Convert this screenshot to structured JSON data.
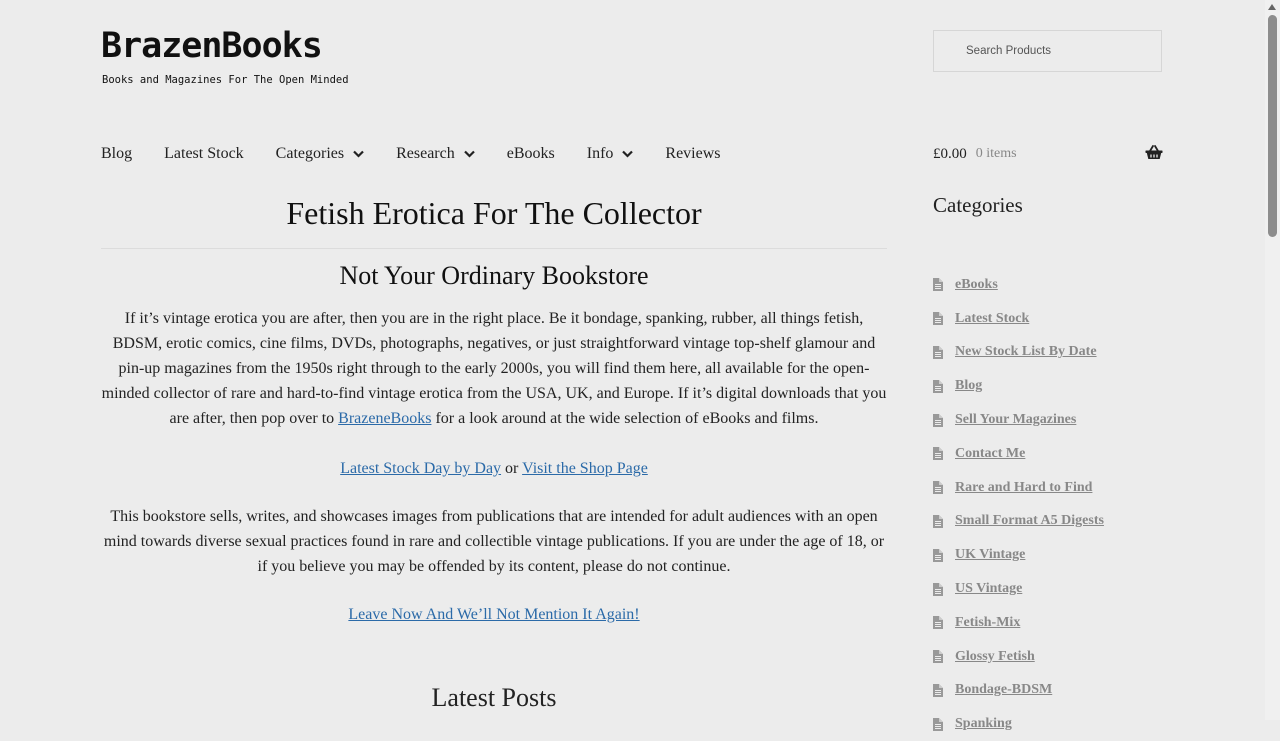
{
  "header": {
    "site_title": "BrazenBooks",
    "tagline": "Books and Magazines For The Open Minded",
    "search_placeholder": "Search Products"
  },
  "nav": {
    "items": [
      {
        "label": "Blog",
        "dropdown": false
      },
      {
        "label": "Latest Stock",
        "dropdown": false
      },
      {
        "label": "Categories",
        "dropdown": true
      },
      {
        "label": "Research",
        "dropdown": true
      },
      {
        "label": "eBooks",
        "dropdown": false
      },
      {
        "label": "Info",
        "dropdown": true
      },
      {
        "label": "Reviews",
        "dropdown": false
      }
    ]
  },
  "cart": {
    "amount": "£0.00",
    "items": "0 items"
  },
  "main": {
    "title": "Fetish Erotica For The Collector",
    "subtitle": "Not Your Ordinary Bookstore",
    "intro_text": "If it’s vintage erotica you are after, then you are in the right place. Be it bondage, spanking, rubber, all things fetish, BDSM, erotic comics, cine films, DVDs, photographs, negatives, or just straightforward vintage top-shelf glamour and pin-up magazines from the 1950s right through to the early 2000s, you will find them here, all available for the open-minded collector of rare and hard-to-find vintage erotica from the USA, UK, and Europe. If it’s digital downloads that you are after, then pop over to ",
    "intro_link": "BrazeneBooks",
    "intro_end": " for a look around at the wide selection of eBooks and films.",
    "link_latest": "Latest Stock Day by Day",
    "link_or": " or ",
    "link_shop": "Visit the Shop Page",
    "warning_text": "This bookstore sells, writes, and showcases images from publications that are intended for adult audiences with an open mind towards diverse sexual practices found in rare and collectible vintage publications. If you are under the age of 18, or if you believe you may be offended by its content, please do not continue.",
    "leave_link": "Leave Now And We’ll Not Mention It Again!",
    "latest_posts": "Latest Posts"
  },
  "sidebar": {
    "title": "Categories",
    "items": [
      "eBooks",
      "Latest Stock",
      "New Stock List By Date",
      "Blog",
      "Sell Your Magazines",
      "Contact Me",
      "Rare and Hard to Find",
      "Small Format A5 Digests",
      "UK Vintage",
      "US Vintage",
      "Fetish-Mix",
      "Glossy Fetish",
      "Bondage-BDSM",
      "Spanking"
    ]
  },
  "colors": {
    "background": "#ececec",
    "link": "#2b6aa8",
    "sidebar_link": "#888888"
  }
}
